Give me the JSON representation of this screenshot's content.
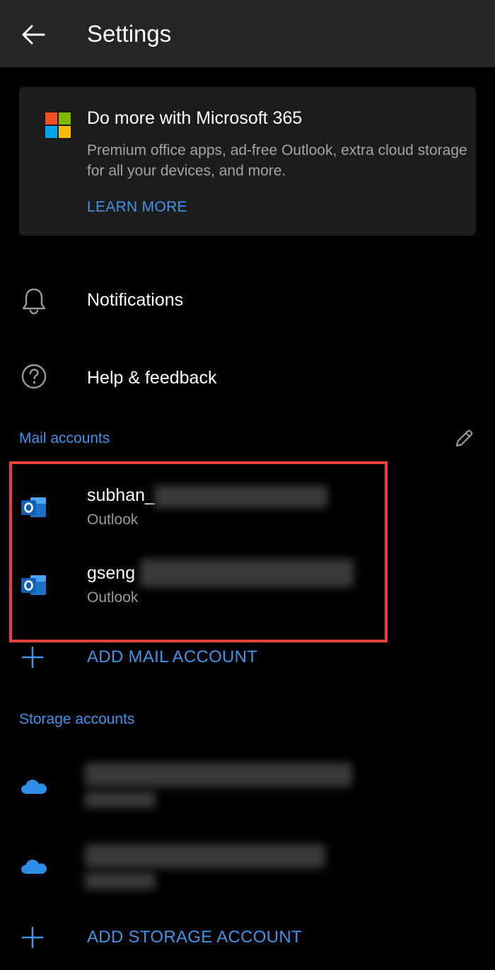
{
  "appbar": {
    "title": "Settings",
    "back_icon": "arrow-left-icon"
  },
  "promo": {
    "title": "Do more with Microsoft 365",
    "description": "Premium office apps, ad-free Outlook, extra cloud storage for all your devices, and more.",
    "link_label": "LEARN MORE",
    "logo_colors": [
      "#f25022",
      "#7fba00",
      "#00a4ef",
      "#ffb900"
    ]
  },
  "menu": {
    "notifications": {
      "label": "Notifications",
      "icon": "bell-icon"
    },
    "help": {
      "label": "Help & feedback",
      "icon": "help-circle-icon"
    }
  },
  "mail_accounts": {
    "header": "Mail accounts",
    "edit_icon": "pencil-icon",
    "items": [
      {
        "name": "subhan_",
        "type": "Outlook",
        "icon": "outlook-icon"
      },
      {
        "name": "gseng",
        "type": "Outlook",
        "icon": "outlook-icon"
      }
    ],
    "add_label": "ADD MAIL ACCOUNT"
  },
  "storage_accounts": {
    "header": "Storage accounts",
    "items": [
      {
        "icon": "onedrive-icon"
      },
      {
        "icon": "onedrive-icon"
      }
    ],
    "add_label": "ADD STORAGE ACCOUNT"
  },
  "colors": {
    "accent": "#3f94e9",
    "highlight": "#e8403f",
    "background": "#000000",
    "appbar": "#262626",
    "card": "#1c1c1c"
  }
}
